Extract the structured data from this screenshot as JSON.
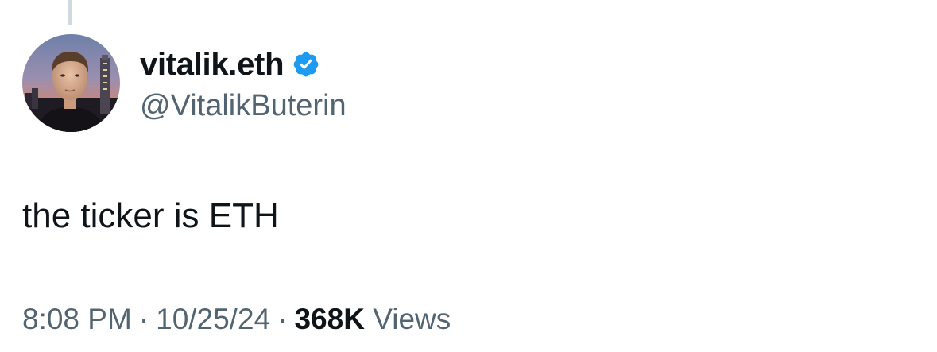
{
  "tweet": {
    "author": {
      "display_name": "vitalik.eth",
      "handle": "@VitalikButerin",
      "verified_icon": "verified-badge-icon",
      "verified_color": "#1d9bf0"
    },
    "text": "the ticker is ETH",
    "meta": {
      "time": "8:08 PM",
      "separator": "·",
      "date": "10/25/24",
      "views_count": "368K",
      "views_label": "Views"
    }
  },
  "colors": {
    "primary_text": "#0f1419",
    "secondary_text": "#536471",
    "thread_line": "#cfd9de",
    "background": "#ffffff"
  }
}
